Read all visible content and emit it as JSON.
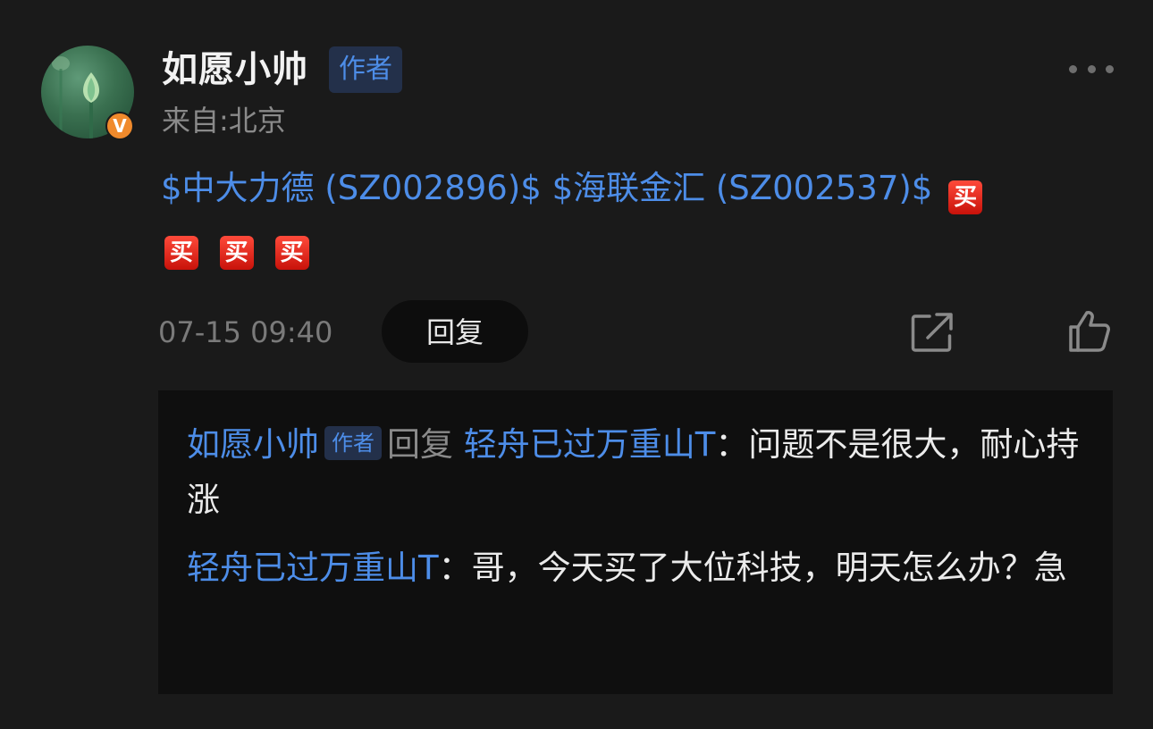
{
  "post": {
    "username": "如愿小帅",
    "author_tag": "作者",
    "location": "来自:北京",
    "badge": "V",
    "stock1": "$中大力德 (SZ002896)$",
    "stock2": "$海联金汇 (SZ002537)$",
    "emoji_label": "买",
    "time": "07-15 09:40",
    "reply_label": "回复"
  },
  "icons": {
    "more": "more-horizontal-icon",
    "share": "share-icon",
    "like": "thumbs-up-icon"
  },
  "replies": [
    {
      "name": "如愿小帅",
      "tag": "作者",
      "action": "回复",
      "target": "轻舟已过万重山T",
      "colon": "：",
      "text": "问题不是很大，耐心持涨"
    },
    {
      "name": "轻舟已过万重山T",
      "colon": "：",
      "text": "哥，今天买了大位科技，明天怎么办？急"
    }
  ],
  "colors": {
    "background": "#1a1a1a",
    "link_blue": "#4d8de8",
    "reply_panel": "#0f0f0f",
    "badge_orange": "#f08a2c",
    "emoji_red": "#e0261a"
  }
}
